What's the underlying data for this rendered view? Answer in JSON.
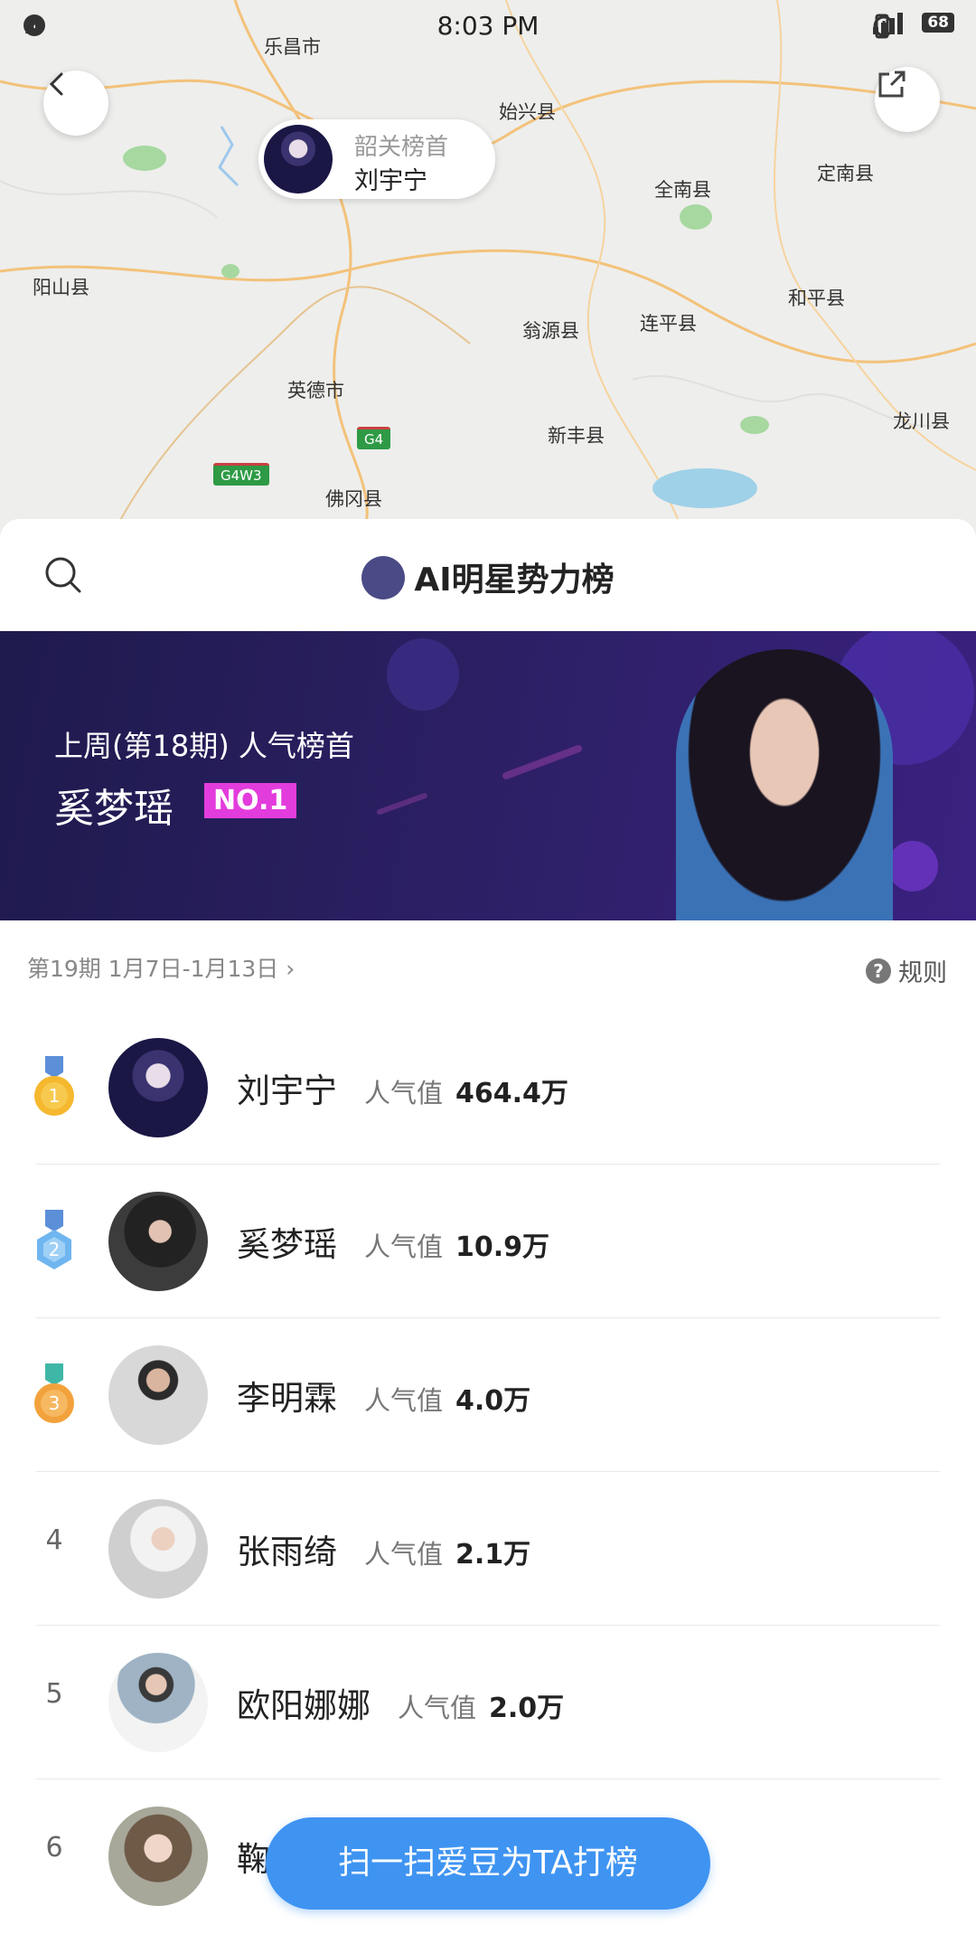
{
  "status_bar": {
    "time": "8:03 PM",
    "notification_count": "1",
    "battery": "68"
  },
  "map": {
    "cities": [
      "乐昌市",
      "始兴县",
      "全南县",
      "定南县",
      "阳山县",
      "翁源县",
      "连平县",
      "和平县",
      "英德市",
      "新丰县",
      "龙川县",
      "佛冈县"
    ],
    "highways": [
      "G4",
      "G4W3"
    ],
    "pin": {
      "title": "韶关榜首",
      "name": "刘宇宁"
    }
  },
  "header": {
    "title": "AI明星势力榜"
  },
  "banner": {
    "subtitle": "上周(第18期) 人气榜首",
    "name": "奚梦瑶",
    "badge": "NO.1"
  },
  "period": {
    "label": "第19期 1月7日-1月13日 ›"
  },
  "rules_label": "规则",
  "rules_icon": "?",
  "popularity_label": "人气值",
  "ranking": [
    {
      "rank": "1",
      "name": "刘宇宁",
      "value": "464.4万"
    },
    {
      "rank": "2",
      "name": "奚梦瑶",
      "value": "10.9万"
    },
    {
      "rank": "3",
      "name": "李明霖",
      "value": "4.0万"
    },
    {
      "rank": "4",
      "name": "张雨绮",
      "value": "2.1万"
    },
    {
      "rank": "5",
      "name": "欧阳娜娜",
      "value": "2.0万"
    },
    {
      "rank": "6",
      "name": "鞠",
      "value": ""
    }
  ],
  "cta": {
    "label": "扫一扫爱豆为TA打榜"
  },
  "colors": {
    "accent": "#3f94f2",
    "banner_bg": "#2b1f62",
    "badge": "#e33cdd",
    "gold": "#f5b82e",
    "silver": "#6fb6f0",
    "bronze": "#f2a23c"
  }
}
